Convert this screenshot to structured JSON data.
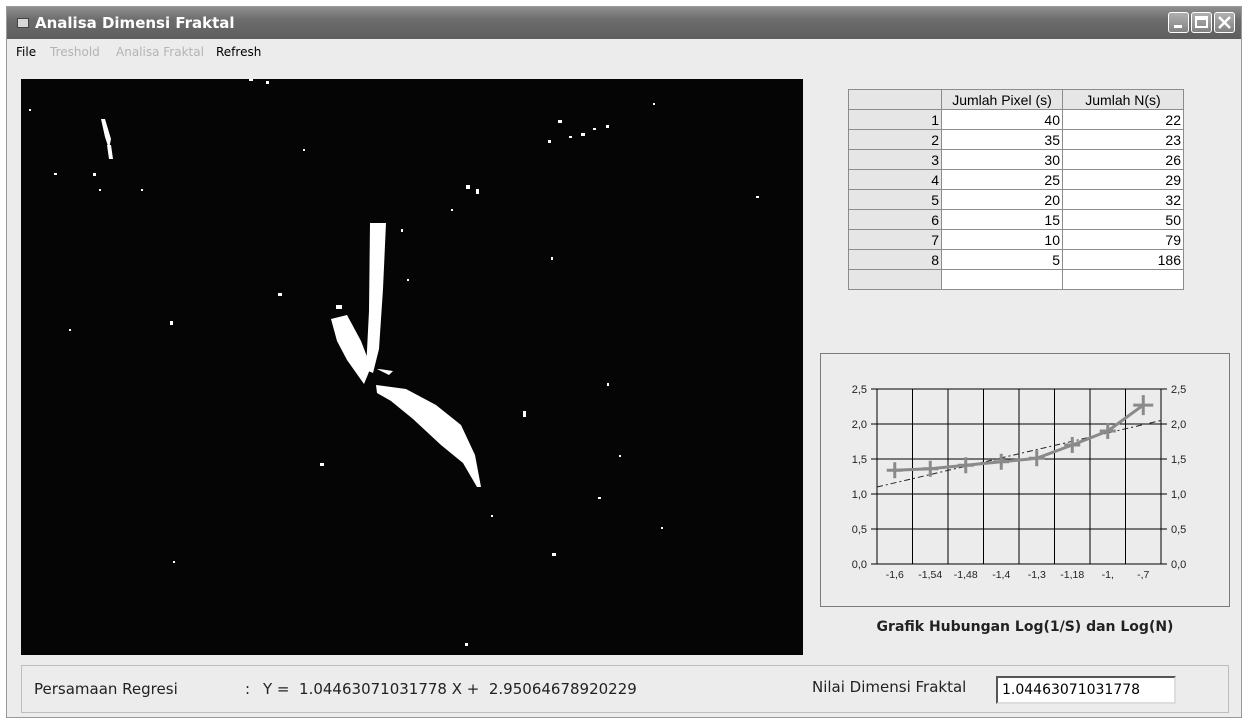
{
  "window": {
    "title": "Analisa Dimensi Fraktal"
  },
  "menu": {
    "items": [
      "File",
      "Treshold",
      "Analisa Fraktal",
      "Refresh"
    ]
  },
  "table": {
    "headers": [
      "",
      "Jumlah Pixel (s)",
      "Jumlah N(s)"
    ],
    "rows": [
      [
        "1",
        "40",
        "22"
      ],
      [
        "2",
        "35",
        "23"
      ],
      [
        "3",
        "30",
        "26"
      ],
      [
        "4",
        "25",
        "29"
      ],
      [
        "5",
        "20",
        "32"
      ],
      [
        "6",
        "15",
        "50"
      ],
      [
        "7",
        "10",
        "79"
      ],
      [
        "8",
        "5",
        "186"
      ]
    ]
  },
  "chart_data": {
    "type": "line",
    "title": "Grafik Hubungan Log(1/S) dan Log(N)",
    "x_tick_labels": [
      "-1,6",
      "-1,54",
      "-1,48",
      "-1,4",
      "-1,3",
      "-1,18",
      "-1,",
      "-,7"
    ],
    "y_tick_labels": [
      "2,5",
      "2,0",
      "1,5",
      "1,0",
      "0,5",
      "0,0"
    ],
    "ylim": [
      0,
      2.5
    ],
    "grid": true,
    "series": [
      {
        "values": [
          1.34,
          1.36,
          1.41,
          1.46,
          1.51,
          1.7,
          1.9,
          2.27
        ]
      }
    ],
    "regression": {
      "slope": 1.04463071031778,
      "intercept": 2.95064678920229
    },
    "colors": {
      "series": "#8a8a8a",
      "grid": "#000000",
      "regression": "#222222"
    }
  },
  "bottom": {
    "regression_label": "Persamaan Regresi",
    "colon": ":",
    "equation": "Y =  1.04463071031778 X +  2.95064678920229",
    "fractal_label": "Nilai Dimensi Fraktal",
    "fractal_value": "1.04463071031778"
  }
}
